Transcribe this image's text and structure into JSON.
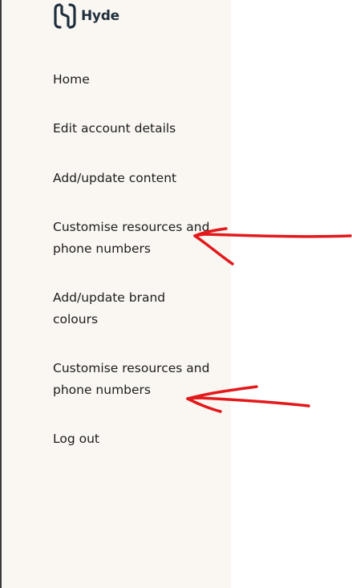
{
  "brand": {
    "name": "Hyde",
    "color": "#1f2f3b"
  },
  "sidebar": {
    "background": "#faf7f3",
    "items": [
      {
        "label": "Home"
      },
      {
        "label": "Edit account details"
      },
      {
        "label": "Add/update content"
      },
      {
        "label": "Customise resources and phone numbers"
      },
      {
        "label": "Add/update brand colours"
      },
      {
        "label": "Customise resources and phone numbers"
      },
      {
        "label": "Log out"
      }
    ]
  },
  "annotations": {
    "arrow_color": "#e3191b",
    "arrows": [
      {
        "points_to": "sidebar-item-customise-resources-1"
      },
      {
        "points_to": "sidebar-item-customise-resources-2"
      }
    ]
  }
}
